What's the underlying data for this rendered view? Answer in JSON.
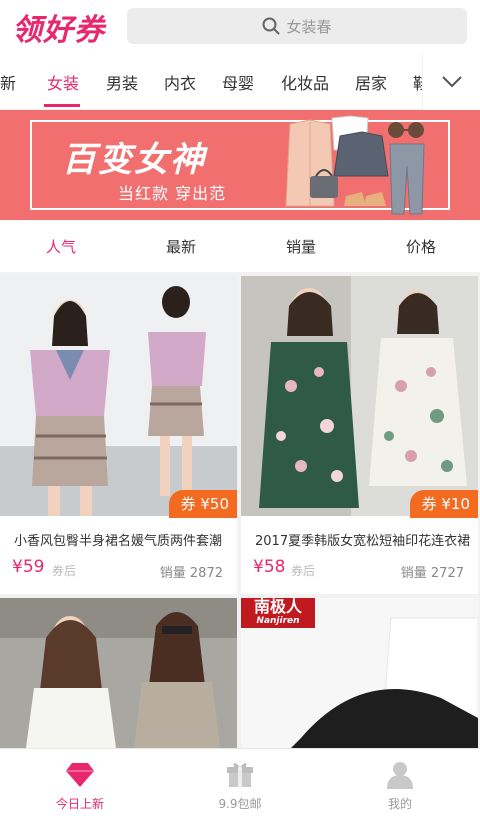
{
  "app": {
    "logo": "领好券"
  },
  "search": {
    "placeholder": "女装春"
  },
  "categories": [
    "上新",
    "女装",
    "男装",
    "内衣",
    "母婴",
    "化妆品",
    "居家",
    "鞋"
  ],
  "banner": {
    "title": "百变女神",
    "subtitle": "当红款 穿出范"
  },
  "sort": [
    "人气",
    "最新",
    "销量",
    "价格"
  ],
  "products": [
    {
      "title": "小香风包臀半身裙名媛气质两件套潮",
      "price": "¥59",
      "price_tag": "券后",
      "sales_label": "销量",
      "sales": "2872",
      "coupon": "券 ¥50"
    },
    {
      "title": "2017夏季韩版女宽松短袖印花连衣裙",
      "price": "¥58",
      "price_tag": "券后",
      "sales_label": "销量",
      "sales": "2727",
      "coupon": "券 ¥10"
    },
    {
      "brand": "南极人",
      "brand_en": "Nanjiren"
    }
  ],
  "tabbar": [
    "今日上新",
    "9.9包邮",
    "我的"
  ],
  "colors": {
    "accent": "#e8276f",
    "coupon": "#f26b21",
    "banner": "#f26f6f"
  }
}
